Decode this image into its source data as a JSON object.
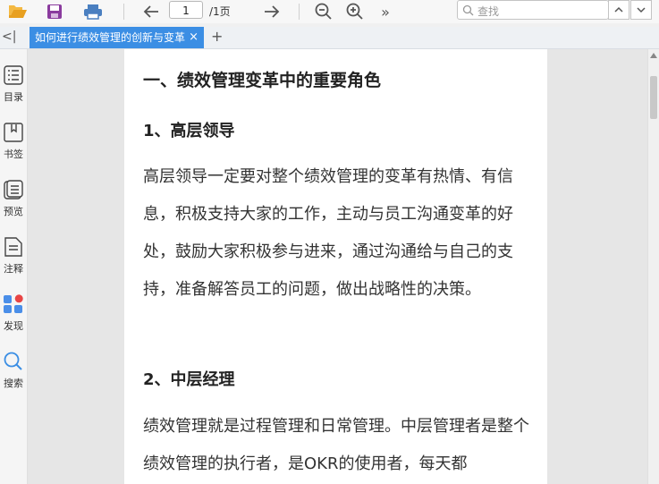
{
  "toolbar": {
    "page_number": "1",
    "page_total": "/1页",
    "more": "»",
    "search_placeholder": "查找",
    "icons": [
      "open-folder-icon",
      "save-icon",
      "print-icon",
      "arrow-left-icon",
      "arrow-right-icon",
      "zoom-out-icon",
      "zoom-in-icon",
      "more-icon",
      "search-icon",
      "chevron-up-icon",
      "chevron-down-icon"
    ]
  },
  "tabs": {
    "collapse": "<|",
    "active_label": "如何进行绩效管理的创新与变革",
    "close": "×",
    "add": "+"
  },
  "sidebar": {
    "items": [
      {
        "label": "目录",
        "icon": "toc-icon"
      },
      {
        "label": "书签",
        "icon": "bookmark-icon"
      },
      {
        "label": "预览",
        "icon": "preview-icon"
      },
      {
        "label": "注释",
        "icon": "annotation-icon"
      },
      {
        "label": "发现",
        "icon": "discover-icon"
      },
      {
        "label": "搜索",
        "icon": "search-icon"
      }
    ]
  },
  "document": {
    "heading": "一、绩效管理变革中的重要角色",
    "section1_title": "1、高层领导",
    "section1_text": "高层领导一定要对整个绩效管理的变革有热情、有信息，积极支持大家的工作，主动与员工沟通变革的好处，鼓励大家积极参与进来，通过沟通给与自己的支持，准备解答员工的问题，做出战略性的决策。",
    "section2_title": "2、中层经理",
    "section2_text": "绩效管理就是过程管理和日常管理。中层管理者是整个绩效管理的执行者，是OKR的使用者，每天都"
  },
  "colors": {
    "tab_active": "#3b8ee4",
    "open_icon": "#e8a020",
    "save_icon": "#8a3b9e",
    "print_icon": "#4a7fc0"
  }
}
